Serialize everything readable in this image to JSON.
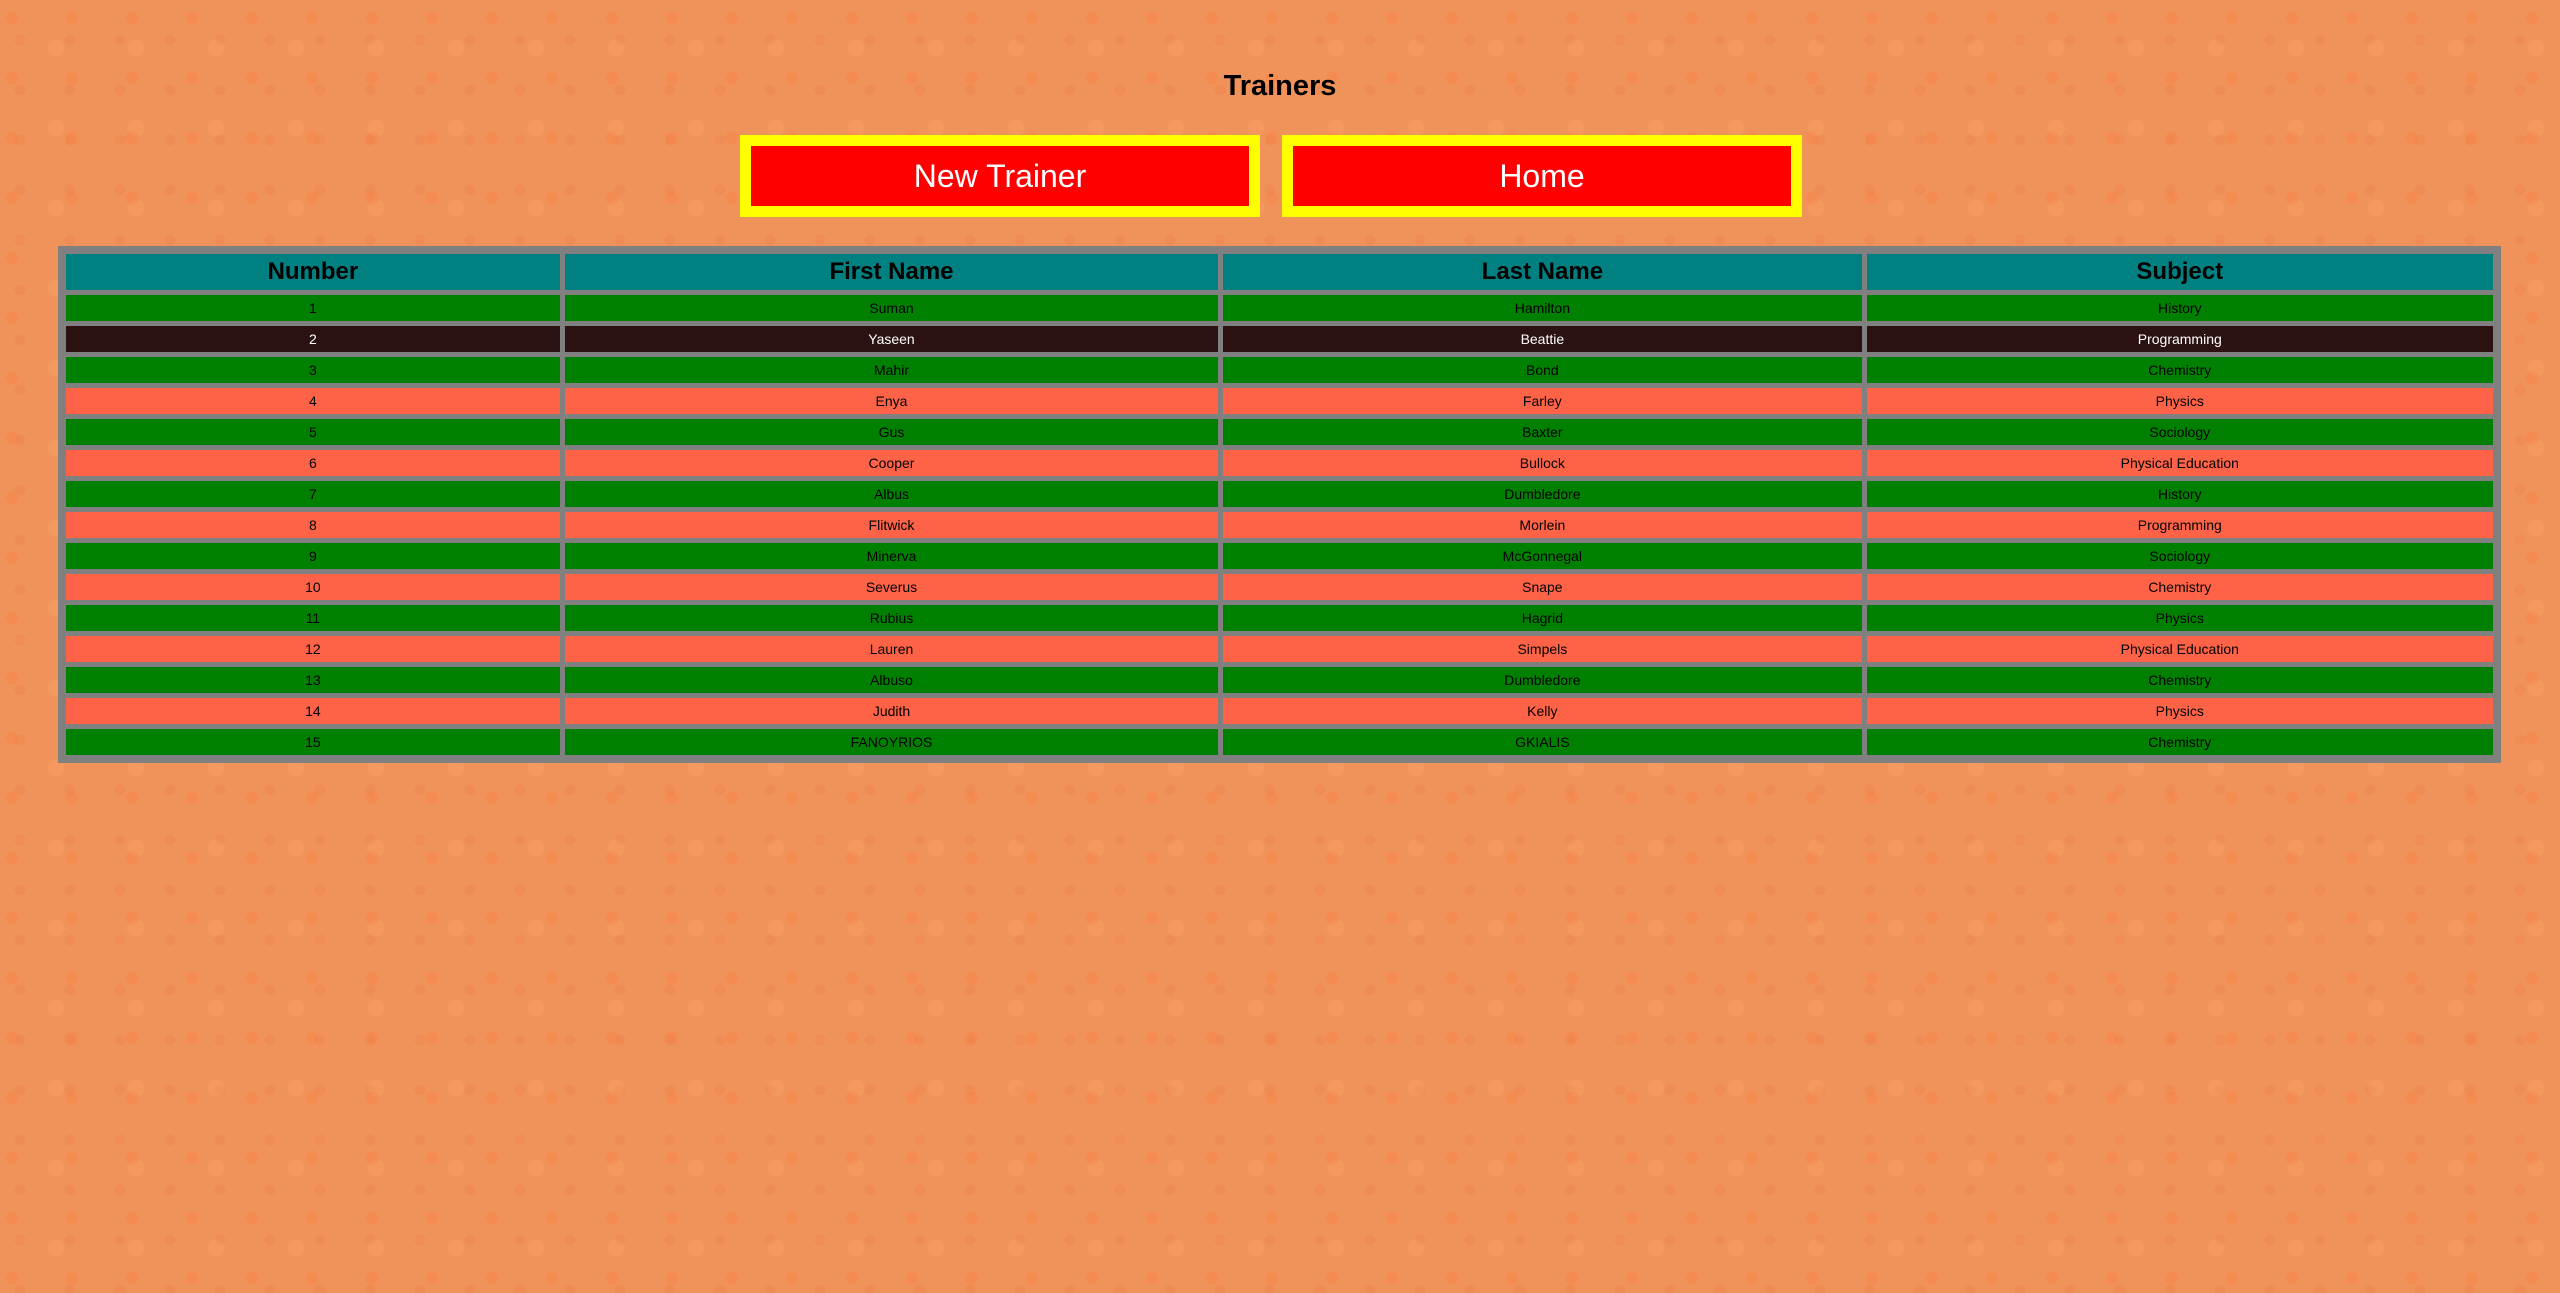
{
  "page": {
    "title": "Trainers"
  },
  "buttons": {
    "new_trainer": "New Trainer",
    "home": "Home"
  },
  "table": {
    "headers": [
      "Number",
      "First Name",
      "Last Name",
      "Subject"
    ],
    "rows": [
      {
        "number": "1",
        "first": "Suman",
        "last": "Hamilton",
        "subject": "History",
        "style": "green"
      },
      {
        "number": "2",
        "first": "Yaseen",
        "last": "Beattie",
        "subject": "Programming",
        "style": "dark"
      },
      {
        "number": "3",
        "first": "Mahir",
        "last": "Bond",
        "subject": "Chemistry",
        "style": "green"
      },
      {
        "number": "4",
        "first": "Enya",
        "last": "Farley",
        "subject": "Physics",
        "style": "salmon"
      },
      {
        "number": "5",
        "first": "Gus",
        "last": "Baxter",
        "subject": "Sociology",
        "style": "green"
      },
      {
        "number": "6",
        "first": "Cooper",
        "last": "Bullock",
        "subject": "Physical Education",
        "style": "salmon"
      },
      {
        "number": "7",
        "first": "Albus",
        "last": "Dumbledore",
        "subject": "History",
        "style": "green"
      },
      {
        "number": "8",
        "first": "Flitwick",
        "last": "Morlein",
        "subject": "Programming",
        "style": "salmon"
      },
      {
        "number": "9",
        "first": "Minerva",
        "last": "McGonnegal",
        "subject": "Sociology",
        "style": "green"
      },
      {
        "number": "10",
        "first": "Severus",
        "last": "Snape",
        "subject": "Chemistry",
        "style": "salmon"
      },
      {
        "number": "11",
        "first": "Rubius",
        "last": "Hagrid",
        "subject": "Physics",
        "style": "green"
      },
      {
        "number": "12",
        "first": "Lauren",
        "last": "Simpels",
        "subject": "Physical Education",
        "style": "salmon"
      },
      {
        "number": "13",
        "first": "Albuso",
        "last": "Dumbledore",
        "subject": "Chemistry",
        "style": "green"
      },
      {
        "number": "14",
        "first": "Judith",
        "last": "Kelly",
        "subject": "Physics",
        "style": "salmon"
      },
      {
        "number": "15",
        "first": "FANOYRIOS",
        "last": "GKIALIS",
        "subject": "Chemistry",
        "style": "green"
      }
    ]
  },
  "colors": {
    "background": "#f0935a",
    "button_fill": "#ff0000",
    "button_border": "#ffff00",
    "header_fill": "#008080",
    "row_green": "#008000",
    "row_salmon": "#ff6347",
    "row_highlight": "#2b1111",
    "table_border": "#808080"
  }
}
